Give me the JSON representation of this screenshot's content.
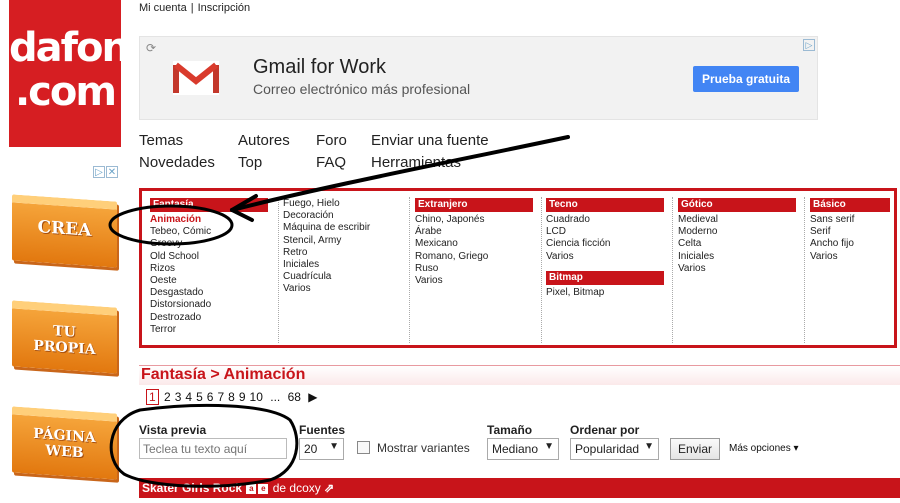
{
  "logo": {
    "line1": "dafont",
    "line2": ".com"
  },
  "top_links": {
    "account": "Mi cuenta",
    "separator": "|",
    "signup": "Inscripción"
  },
  "ad": {
    "title": "Gmail for Work",
    "subtitle": "Correo electrónico más profesional",
    "cta": "Prueba gratuita",
    "refresh_icon": "refresh-icon",
    "ad_choices_icon": "adchoices-icon"
  },
  "side_promos": {
    "ad_flag": "▷",
    "ad_close": "✕",
    "promo1": "CREA",
    "promo2_line1": "TU",
    "promo2_line2": "PROPIA",
    "promo3_line1": "PÁGINA",
    "promo3_line2": "WEB"
  },
  "nav": {
    "temas": "Temas",
    "autores": "Autores",
    "foro": "Foro",
    "enviar": "Enviar una fuente",
    "novedades": "Novedades",
    "top": "Top",
    "faq": "FAQ",
    "herramientas": "Herramientas"
  },
  "categories": {
    "fantasia": {
      "header": "Fantasía",
      "selected": "Animación",
      "items": [
        "Tebeo, Cómic",
        "Groovy",
        "Old School",
        "Rizos",
        "Oeste",
        "Desgastado",
        "Distorsionado",
        "Destrozado",
        "Terror"
      ]
    },
    "fantasia2": {
      "items": [
        "Fuego, Hielo",
        "Decoración",
        "Máquina de escribir",
        "Stencil, Army",
        "Retro",
        "Iniciales",
        "Cuadrícula",
        "Varios"
      ]
    },
    "extranjero": {
      "header": "Extranjero",
      "items": [
        "Chino, Japonés",
        "Árabe",
        "Mexicano",
        "Romano, Griego",
        "Ruso",
        "Varios"
      ]
    },
    "tecno": {
      "header": "Tecno",
      "items": [
        "Cuadrado",
        "LCD",
        "Ciencia ficción",
        "Varios"
      ]
    },
    "bitmap": {
      "header": "Bitmap",
      "items": [
        "Pixel, Bitmap"
      ]
    },
    "gotico": {
      "header": "Gótico",
      "items": [
        "Medieval",
        "Moderno",
        "Celta",
        "Iniciales",
        "Varios"
      ]
    },
    "basico": {
      "header": "Básico",
      "items": [
        "Sans serif",
        "Serif",
        "Ancho fijo",
        "Varios"
      ]
    }
  },
  "breadcrumb": "Fantasía > Animación",
  "pagination": {
    "current": "1",
    "pages": [
      "2",
      "3",
      "4",
      "5",
      "6",
      "7",
      "8",
      "9",
      "10"
    ],
    "ellipsis": "...",
    "last": "68",
    "next": "▶"
  },
  "preview": {
    "label": "Vista previa",
    "placeholder": "Teclea tu texto aquí",
    "fonts_label": "Fuentes",
    "fonts_value": "20",
    "variants_label": "Mostrar variantes",
    "size_label": "Tamaño",
    "size_value": "Mediano",
    "order_label": "Ordenar por",
    "order_value": "Popularidad",
    "submit": "Enviar",
    "more": "Más opciones ▾"
  },
  "font_entry": {
    "name": "Skater Girls Rock",
    "icon1": "a",
    "icon2": "e",
    "by": "de dcoxy",
    "external_icon": "external-link-icon"
  },
  "colors": {
    "brand_red": "#c8141a",
    "ad_blue": "#4285f4",
    "promo_orange": "#ec8c22"
  }
}
